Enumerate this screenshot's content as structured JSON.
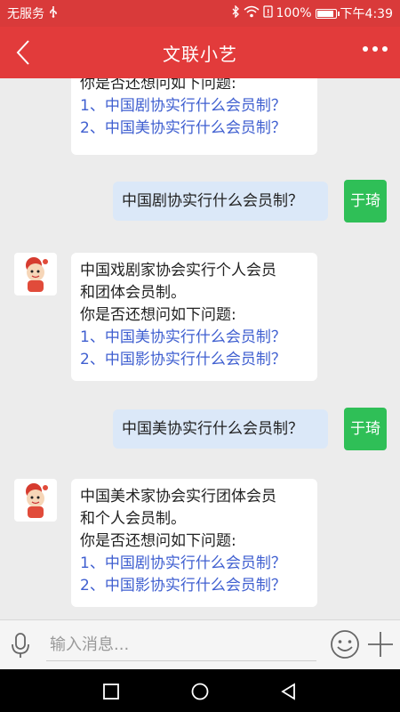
{
  "status_bar": {
    "carrier": "无服务",
    "battery": "100%",
    "battery_level": 0.95,
    "time": "下午4:39"
  },
  "header": {
    "title": "文联小艺",
    "back_icon": "chevron-left-icon",
    "more_icon": "more-dots-icon"
  },
  "messages": [
    {
      "from": "bot",
      "lines": [
        "你是否还想问如下问题:"
      ],
      "links": [
        "1、中国剧协实行什么会员制？",
        "2、中国美协实行什么会员制？"
      ]
    },
    {
      "from": "user",
      "avatar_label": "于琦",
      "text": "中国剧协实行什么会员制？"
    },
    {
      "from": "bot",
      "lines": [
        "中国戏剧家协会实行个人会员",
        "和团体会员制。",
        "你是否还想问如下问题:"
      ],
      "links": [
        "1、中国美协实行什么会员制？",
        "2、中国影协实行什么会员制？"
      ]
    },
    {
      "from": "user",
      "avatar_label": "于琦",
      "text": "中国美协实行什么会员制？"
    },
    {
      "from": "bot",
      "lines": [
        "中国美术家协会实行团体会员",
        "和个人会员制。",
        "你是否还想问如下问题:"
      ],
      "links": [
        "1、中国剧协实行什么会员制？",
        "2、中国影协实行什么会员制？"
      ]
    }
  ],
  "input": {
    "placeholder": "输入消息..."
  },
  "colors": {
    "header_bg": "#e23b3b",
    "user_avatar": "#2fbf57",
    "link": "#3f5fd0",
    "user_bubble": "#dbe8f8"
  }
}
